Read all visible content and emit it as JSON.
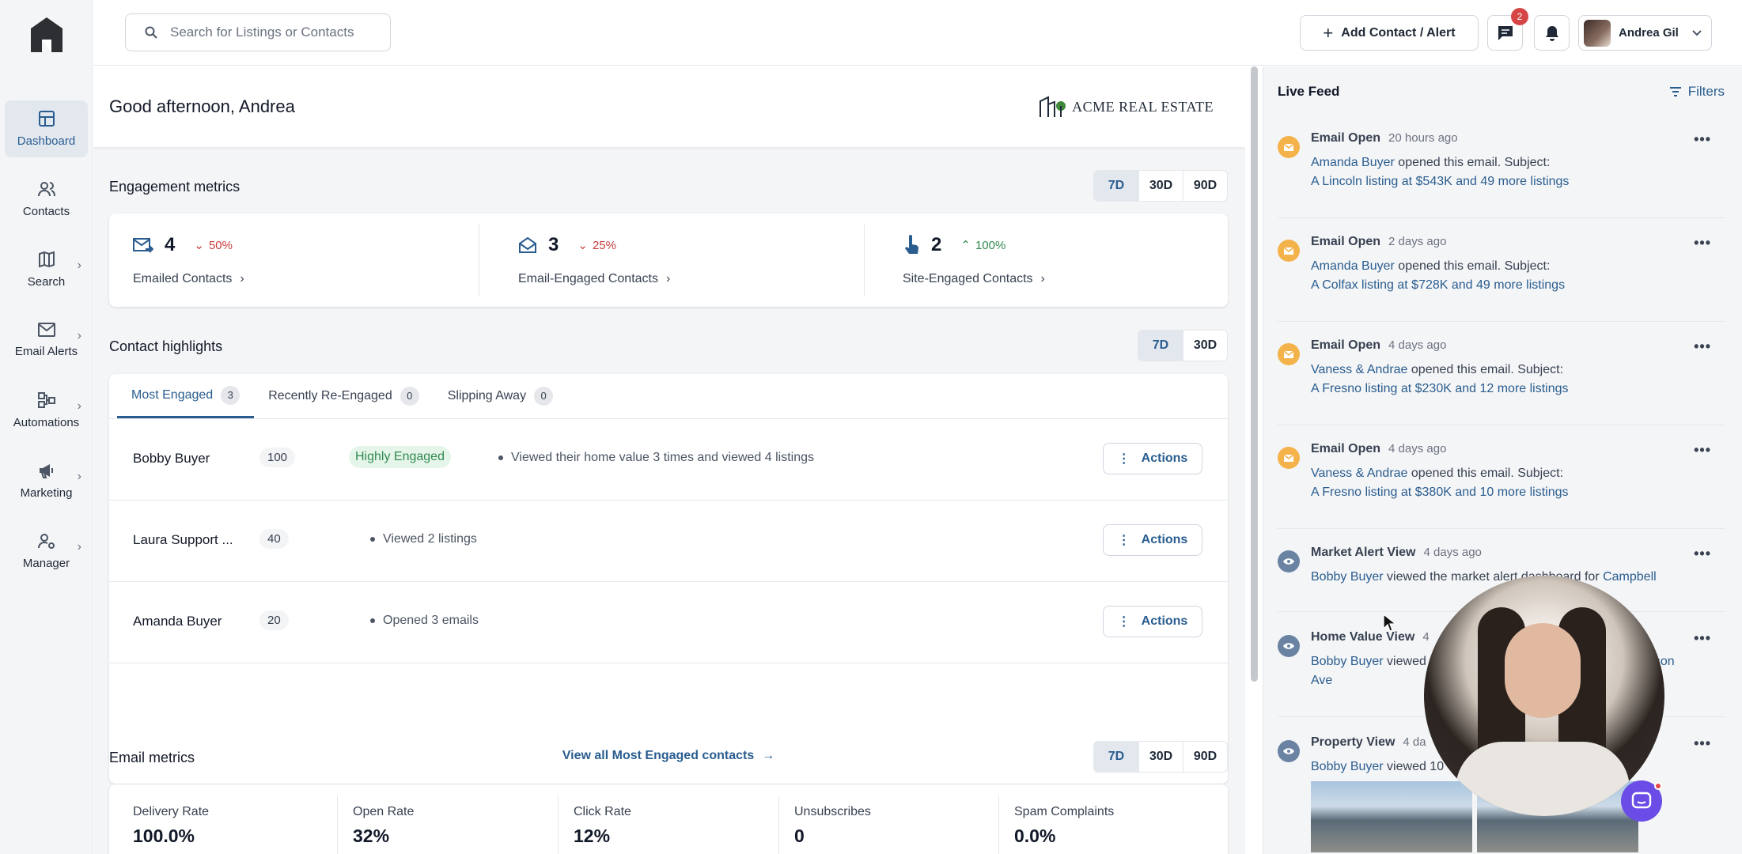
{
  "sidebar": {
    "items": [
      {
        "label": "Dashboard",
        "icon": "dashboard-icon",
        "active": true
      },
      {
        "label": "Contacts",
        "icon": "contacts-icon"
      },
      {
        "label": "Search",
        "icon": "map-icon"
      },
      {
        "label": "Email Alerts",
        "icon": "mail-icon"
      },
      {
        "label": "Automations",
        "icon": "automations-icon"
      },
      {
        "label": "Marketing",
        "icon": "megaphone-icon"
      },
      {
        "label": "Manager",
        "icon": "manager-icon"
      }
    ]
  },
  "topbar": {
    "search_placeholder": "Search for Listings or Contacts",
    "add_label": "Add Contact / Alert",
    "messages_badge": "2",
    "user_name": "Andrea Gil"
  },
  "greeting": {
    "text": "Good afternoon, Andrea",
    "brand": "ACME REAL ESTATE"
  },
  "engagement": {
    "title": "Engagement metrics",
    "periods": [
      "7D",
      "30D",
      "90D"
    ],
    "metrics": [
      {
        "value": "4",
        "change": "50%",
        "direction": "down",
        "label": "Emailed Contacts"
      },
      {
        "value": "3",
        "change": "25%",
        "direction": "down",
        "label": "Email-Engaged Contacts"
      },
      {
        "value": "2",
        "change": "100%",
        "direction": "up",
        "label": "Site-Engaged Contacts"
      }
    ]
  },
  "highlights": {
    "title": "Contact highlights",
    "periods": [
      "7D",
      "30D"
    ],
    "tabs": [
      {
        "label": "Most Engaged",
        "count": "3"
      },
      {
        "label": "Recently Re-Engaged",
        "count": "0"
      },
      {
        "label": "Slipping Away",
        "count": "0"
      }
    ],
    "rows": [
      {
        "name": "Bobby Buyer",
        "score": "100",
        "tag": "Highly Engaged",
        "desc": "Viewed their home value 3 times and viewed 4 listings"
      },
      {
        "name": "Laura Support ...",
        "score": "40",
        "tag": "",
        "desc": "Viewed 2 listings"
      },
      {
        "name": "Amanda Buyer",
        "score": "20",
        "tag": "",
        "desc": "Opened 3 emails"
      }
    ],
    "actions_label": "Actions",
    "view_all": "View all Most Engaged contacts"
  },
  "email_metrics": {
    "title": "Email metrics",
    "periods": [
      "7D",
      "30D",
      "90D"
    ],
    "items": [
      {
        "label": "Delivery Rate",
        "value": "100.0%"
      },
      {
        "label": "Open Rate",
        "value": "32%"
      },
      {
        "label": "Click Rate",
        "value": "12%"
      },
      {
        "label": "Unsubscribes",
        "value": "0"
      },
      {
        "label": "Spam Complaints",
        "value": "0.0%"
      }
    ]
  },
  "feed": {
    "title": "Live Feed",
    "filters_label": "Filters",
    "more": "•••",
    "items": [
      {
        "type": "Email Open",
        "ago": "20 hours ago",
        "who": "Amanda Buyer",
        "text": " opened this email. Subject:",
        "link": "A Lincoln listing at $543K and 49 more listings"
      },
      {
        "type": "Email Open",
        "ago": "2 days ago",
        "who": "Amanda Buyer",
        "text": " opened this email. Subject:",
        "link": "A Colfax listing at $728K and 49 more listings"
      },
      {
        "type": "Email Open",
        "ago": "4 days ago",
        "who": "Vaness & Andrae",
        "text": " opened this email. Subject:",
        "link": "A Fresno listing at $230K and 12 more listings"
      },
      {
        "type": "Email Open",
        "ago": "4 days ago",
        "who": "Vaness & Andrae",
        "text": " opened this email. Subject:",
        "link": "A Fresno listing at $380K and 10 more listings"
      },
      {
        "type": "Market Alert View",
        "ago": "4 days ago",
        "who": "Bobby Buyer",
        "text": " viewed the market alert dashboard for ",
        "link": "Campbell"
      },
      {
        "type": "Home Value View",
        "ago": "4",
        "who": "Bobby Buyer",
        "text": " viewed",
        "link": "rison",
        "line2": "Ave"
      },
      {
        "type": "Property View",
        "ago": "4 da",
        "who": "Bobby Buyer",
        "text": " viewed 10"
      }
    ]
  }
}
